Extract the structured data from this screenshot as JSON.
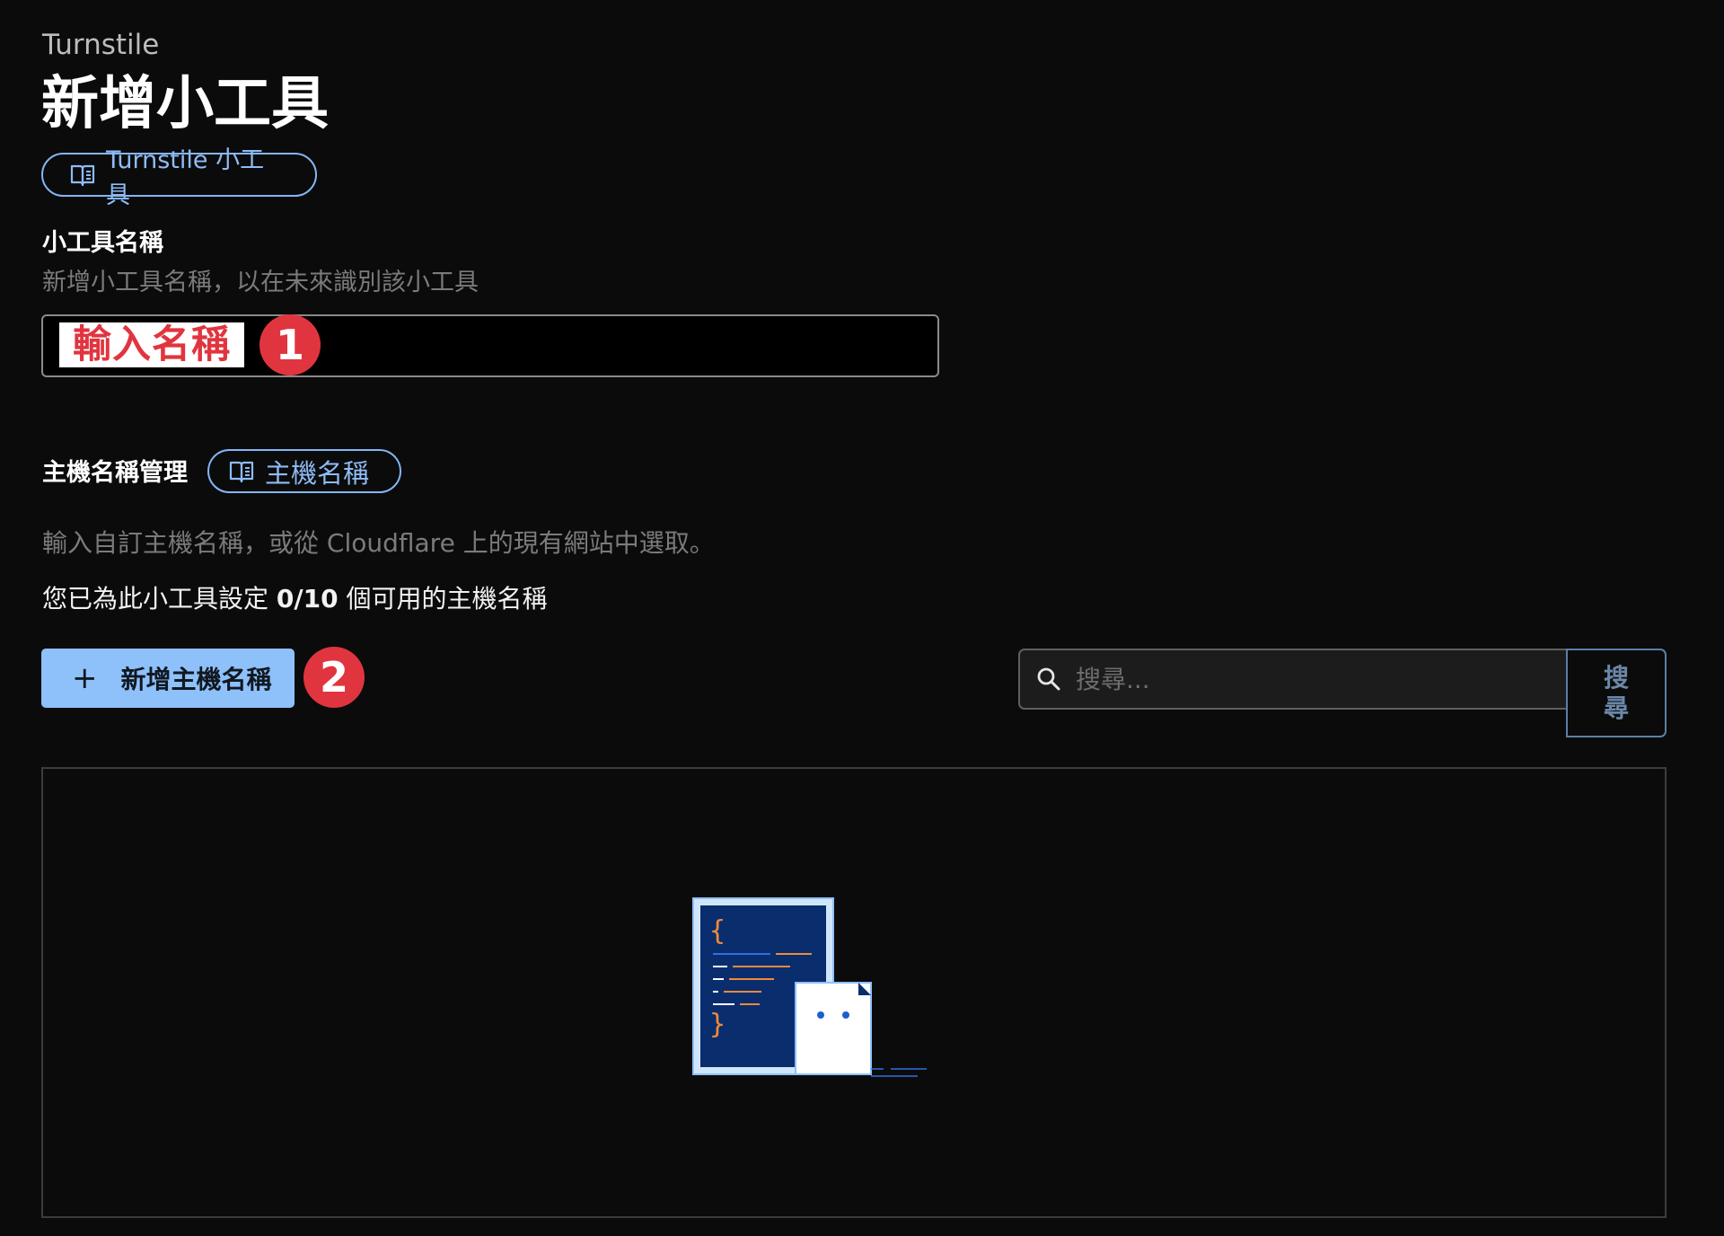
{
  "header": {
    "product": "Turnstile",
    "title": "新增小工具",
    "docs_link": "Turnstile 小工具"
  },
  "widget_name": {
    "label": "小工具名稱",
    "help": "新增小工具名稱，以在未來識別該小工具",
    "input_value": "",
    "annotation": "輸入名稱",
    "step": "1"
  },
  "hostnames": {
    "label": "主機名稱管理",
    "docs_link": "主機名稱",
    "help": "輸入自訂主機名稱，或從 Cloudflare 上的現有網站中選取。",
    "usage_prefix": "您已為此小工具設定 ",
    "usage_count": "0/10",
    "usage_suffix": " 個可用的主機名稱",
    "add_button": "新增主機名稱",
    "add_icon": "+",
    "step": "2",
    "search_placeholder": "搜尋...",
    "search_button": "搜尋"
  },
  "icons": {
    "docs": "book-icon",
    "search": "magnifier-icon",
    "add": "plus-icon",
    "empty_state": "code-document-illustration"
  },
  "colors": {
    "accent": "#8ec0fa",
    "annotation_red": "#e0353f",
    "background": "#0b0b0b"
  }
}
